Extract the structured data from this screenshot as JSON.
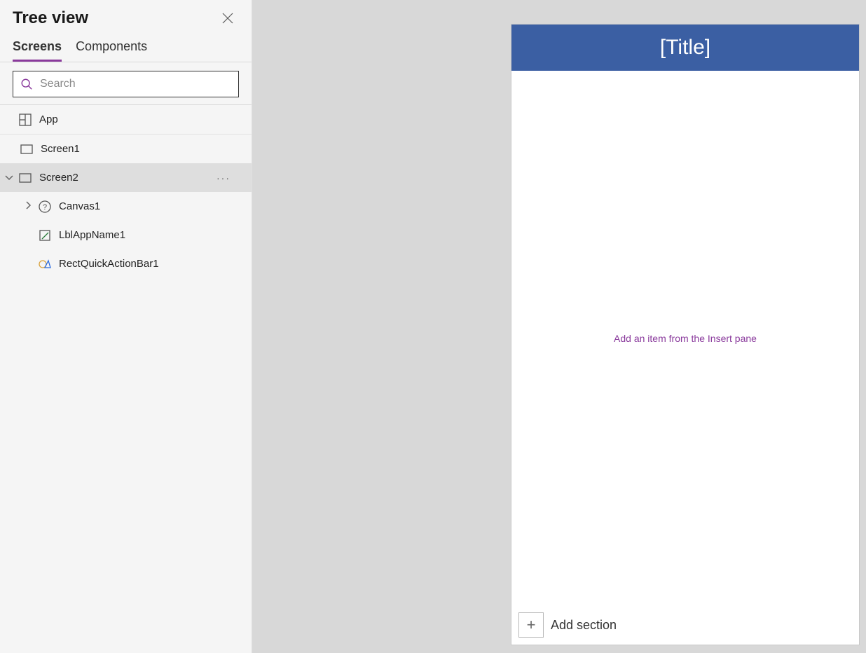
{
  "panel": {
    "title": "Tree view"
  },
  "tabs": {
    "screens": "Screens",
    "components": "Components"
  },
  "search": {
    "placeholder": "Search"
  },
  "tree": {
    "app": "App",
    "screen1": "Screen1",
    "screen2": "Screen2",
    "canvas1": "Canvas1",
    "lblAppName1": "LblAppName1",
    "rectQuickActionBar1": "RectQuickActionBar1"
  },
  "canvas": {
    "title": "[Title]",
    "hint": "Add an item from the Insert pane",
    "addSection": "Add section"
  }
}
